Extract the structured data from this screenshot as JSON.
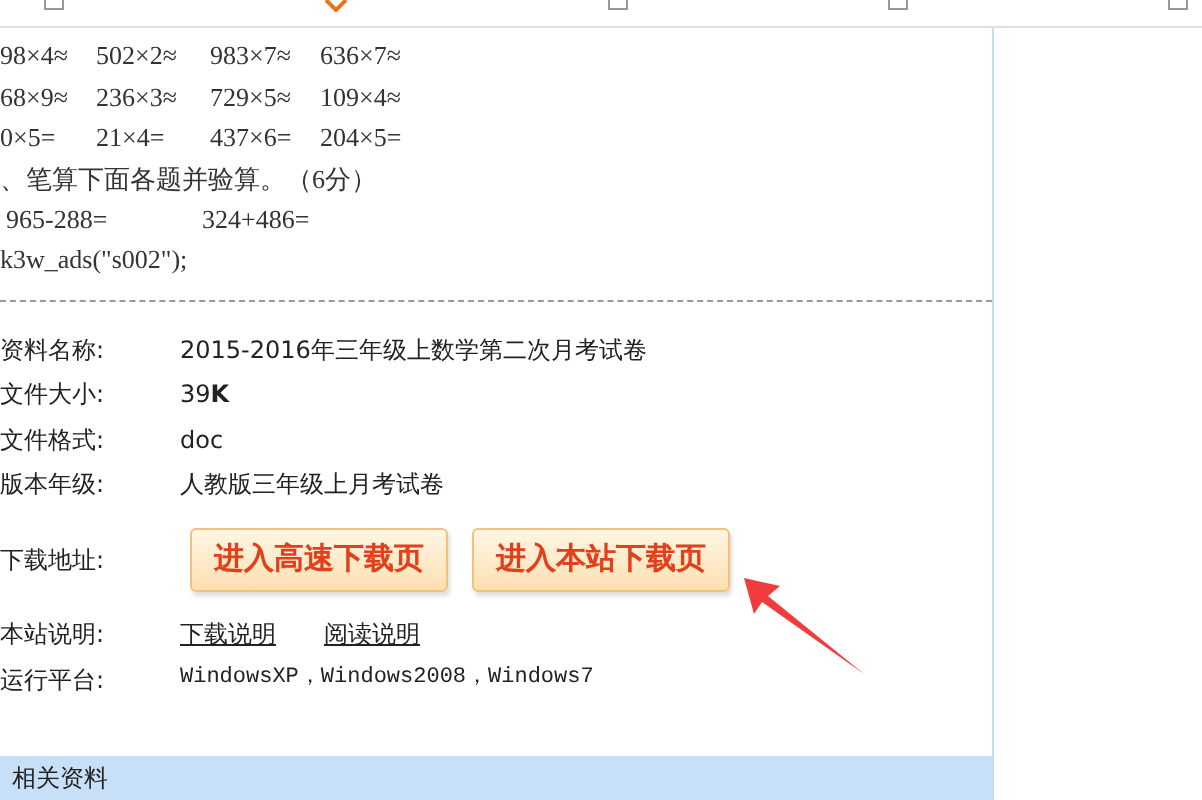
{
  "math_rows": [
    [
      "98×4≈",
      "502×2≈",
      "983×7≈",
      "636×7≈"
    ],
    [
      "68×9≈",
      "236×3≈",
      "729×5≈",
      "109×4≈"
    ],
    [
      "0×5=",
      "21×4=",
      "437×6=",
      "204×5="
    ]
  ],
  "question": "、笔算下面各题并验算。（6分）",
  "calc_row": [
    "965-288=",
    "324+486="
  ],
  "script_line": "k3w_ads(\"s002\");",
  "info": [
    {
      "label": "资料名称:",
      "value": "2015-2016年三年级上数学第二次月考试卷"
    },
    {
      "label": "文件大小:",
      "value": "39**K**"
    },
    {
      "label": "文件格式:",
      "value": "doc"
    },
    {
      "label": "版本年级:",
      "value": "人教版三年级上月考试卷"
    }
  ],
  "download": {
    "label": "下载地址:",
    "buttons": [
      "进入高速下载页",
      "进入本站下载页"
    ]
  },
  "site_notes": {
    "label": "本站说明:",
    "links": [
      "下载说明",
      "阅读说明"
    ]
  },
  "platform": {
    "label": "运行平台:",
    "value": "WindowsXP，Windows2008，Windows7"
  },
  "related": {
    "title": "相关资料"
  }
}
